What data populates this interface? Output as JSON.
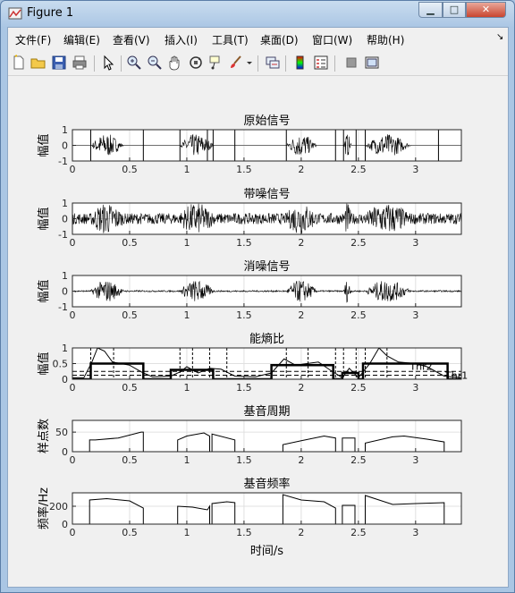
{
  "window": {
    "title": "Figure 1",
    "minimize_glyph": "▁",
    "maximize_glyph": "□",
    "close_glyph": "✕"
  },
  "menubar": {
    "items": [
      "文件(F)",
      "编辑(E)",
      "查看(V)",
      "插入(I)",
      "工具(T)",
      "桌面(D)",
      "窗口(W)",
      "帮助(H)"
    ],
    "dock_glyph": "↘"
  },
  "toolbar": {
    "icons": [
      "new-figure-icon",
      "open-file-icon",
      "save-icon",
      "print-icon",
      "edit-plot-arrow-icon",
      "zoom-in-icon",
      "zoom-out-icon",
      "pan-hand-icon",
      "rotate-3d-icon",
      "data-cursor-icon",
      "brush-icon",
      "brush-dropdown-icon",
      "link-plot-icon",
      "insert-colorbar-icon",
      "insert-legend-icon",
      "hide-plot-tools-icon",
      "show-plot-tools-icon"
    ]
  },
  "colors": {
    "accent_line": "#000000",
    "grid": "#e0e0e0",
    "axes_bg": "#ffffff"
  },
  "chart_data": [
    {
      "type": "line",
      "title": "原始信号",
      "xlabel": "",
      "ylabel": "幅值",
      "xlim": [
        0,
        3.4
      ],
      "ylim": [
        -1,
        1
      ],
      "xticks": [
        "0",
        "0.5",
        "1",
        "1.5",
        "2",
        "2.5",
        "3"
      ],
      "yticks": [
        "-1",
        "0",
        "1"
      ],
      "description_series": "speech waveform",
      "segments": [
        [
          0.16,
          0.62
        ],
        [
          0.94,
          1.42
        ],
        [
          1.87,
          2.3
        ],
        [
          2.37,
          2.48
        ],
        [
          2.56,
          3.2
        ]
      ],
      "vlines": [
        0.16,
        0.62,
        0.94,
        1.18,
        1.23,
        1.42,
        1.87,
        2.3,
        2.37,
        2.48,
        2.56,
        3.2
      ]
    },
    {
      "type": "line",
      "title": "带噪信号",
      "xlabel": "",
      "ylabel": "幅值",
      "xlim": [
        0,
        3.4
      ],
      "ylim": [
        -1,
        1
      ],
      "xticks": [
        "0",
        "0.5",
        "1",
        "1.5",
        "2",
        "2.5",
        "3"
      ],
      "yticks": [
        "-1",
        "0",
        "1"
      ]
    },
    {
      "type": "line",
      "title": "消噪信号",
      "xlabel": "",
      "ylabel": "幅值",
      "xlim": [
        0,
        3.4
      ],
      "ylim": [
        -1,
        1
      ],
      "xticks": [
        "0",
        "0.5",
        "1",
        "1.5",
        "2",
        "2.5",
        "3"
      ],
      "yticks": [
        "-1",
        "0",
        "1"
      ]
    },
    {
      "type": "line",
      "title": "能熵比",
      "xlabel": "",
      "ylabel": "幅值",
      "xlim": [
        0,
        3.4
      ],
      "ylim": [
        0,
        1
      ],
      "xticks": [
        "0",
        "0.5",
        "1",
        "1.5",
        "2",
        "2.5",
        "3"
      ],
      "yticks": [
        "0",
        "0.5",
        "1"
      ],
      "thresholds": [
        {
          "name": "Thr2",
          "value": 0.25
        },
        {
          "name": "Thr1",
          "value": 0.13
        }
      ],
      "annotations": [
        "Thr2",
        "Thr1"
      ],
      "step_series": [
        [
          0,
          0
        ],
        [
          0.16,
          0
        ],
        [
          0.16,
          0.5
        ],
        [
          0.62,
          0.5
        ],
        [
          0.62,
          0
        ],
        [
          0.86,
          0
        ],
        [
          0.86,
          0.3
        ],
        [
          1.23,
          0.3
        ],
        [
          1.23,
          0
        ],
        [
          1.42,
          0
        ],
        [
          1.42,
          0
        ],
        [
          1.74,
          0
        ],
        [
          1.74,
          0.45
        ],
        [
          2.28,
          0.45
        ],
        [
          2.28,
          0
        ],
        [
          2.36,
          0
        ],
        [
          2.36,
          0.2
        ],
        [
          2.5,
          0.2
        ],
        [
          2.5,
          0
        ],
        [
          2.54,
          0
        ],
        [
          2.54,
          0.5
        ],
        [
          3.28,
          0.5
        ],
        [
          3.28,
          0
        ],
        [
          3.4,
          0
        ]
      ],
      "curve": [
        [
          0,
          0.05
        ],
        [
          0.1,
          0.05
        ],
        [
          0.17,
          0.55
        ],
        [
          0.22,
          1.0
        ],
        [
          0.28,
          0.9
        ],
        [
          0.35,
          0.55
        ],
        [
          0.5,
          0.45
        ],
        [
          0.62,
          0.2
        ],
        [
          0.7,
          0.08
        ],
        [
          0.86,
          0.1
        ],
        [
          0.95,
          0.25
        ],
        [
          1.0,
          0.4
        ],
        [
          1.05,
          0.3
        ],
        [
          1.1,
          0.2
        ],
        [
          1.2,
          0.35
        ],
        [
          1.3,
          0.32
        ],
        [
          1.42,
          0.1
        ],
        [
          1.6,
          0.08
        ],
        [
          1.74,
          0.2
        ],
        [
          1.85,
          0.65
        ],
        [
          1.95,
          0.45
        ],
        [
          2.05,
          0.5
        ],
        [
          2.15,
          0.55
        ],
        [
          2.25,
          0.3
        ],
        [
          2.36,
          0.05
        ],
        [
          2.42,
          0.35
        ],
        [
          2.5,
          0.05
        ],
        [
          2.6,
          0.5
        ],
        [
          2.68,
          1.0
        ],
        [
          2.75,
          0.75
        ],
        [
          2.85,
          0.55
        ],
        [
          3.0,
          0.5
        ],
        [
          3.1,
          0.4
        ],
        [
          3.25,
          0.1
        ],
        [
          3.4,
          0.05
        ]
      ],
      "vlines": [
        0.16,
        0.36,
        0.94,
        1.05,
        1.2,
        1.35,
        1.87,
        2.06,
        2.3,
        2.37,
        2.48,
        2.56,
        2.75
      ]
    },
    {
      "type": "line",
      "title": "基音周期",
      "xlabel": "",
      "ylabel": "样点数",
      "xlim": [
        0,
        3.4
      ],
      "ylim": [
        0,
        80
      ],
      "xticks": [
        "0",
        "0.5",
        "1",
        "1.5",
        "2",
        "2.5",
        "3"
      ],
      "yticks": [
        "0",
        "50"
      ],
      "series": [
        [
          0.0,
          0
        ],
        [
          0.15,
          0
        ],
        [
          0.15,
          30
        ],
        [
          0.2,
          30
        ],
        [
          0.4,
          35
        ],
        [
          0.6,
          50
        ],
        [
          0.62,
          50
        ],
        [
          0.62,
          0
        ],
        [
          0.92,
          0
        ],
        [
          0.92,
          30
        ],
        [
          1.0,
          40
        ],
        [
          1.15,
          48
        ],
        [
          1.2,
          40
        ],
        [
          1.2,
          0
        ],
        [
          1.22,
          0
        ],
        [
          1.22,
          45
        ],
        [
          1.42,
          30
        ],
        [
          1.42,
          0
        ],
        [
          1.6,
          0
        ],
        [
          1.84,
          0
        ],
        [
          1.84,
          18
        ],
        [
          2.0,
          28
        ],
        [
          2.2,
          40
        ],
        [
          2.3,
          35
        ],
        [
          2.3,
          0
        ],
        [
          2.36,
          0
        ],
        [
          2.36,
          35
        ],
        [
          2.47,
          35
        ],
        [
          2.47,
          0
        ],
        [
          2.56,
          0
        ],
        [
          2.56,
          22
        ],
        [
          2.8,
          38
        ],
        [
          2.9,
          40
        ],
        [
          3.1,
          32
        ],
        [
          3.25,
          25
        ],
        [
          3.25,
          0
        ],
        [
          3.4,
          0
        ]
      ]
    },
    {
      "type": "line",
      "title": "基音频率",
      "xlabel": "时间/s",
      "ylabel": "频率/Hz",
      "xlim": [
        0,
        3.4
      ],
      "ylim": [
        0,
        350
      ],
      "xticks": [
        "0",
        "0.5",
        "1",
        "1.5",
        "2",
        "2.5",
        "3"
      ],
      "yticks": [
        "0",
        "200"
      ],
      "series": [
        [
          0.0,
          0
        ],
        [
          0.15,
          0
        ],
        [
          0.15,
          270
        ],
        [
          0.3,
          285
        ],
        [
          0.5,
          260
        ],
        [
          0.62,
          180
        ],
        [
          0.62,
          0
        ],
        [
          0.92,
          0
        ],
        [
          0.92,
          200
        ],
        [
          1.05,
          190
        ],
        [
          1.18,
          160
        ],
        [
          1.2,
          200
        ],
        [
          1.2,
          0
        ],
        [
          1.22,
          0
        ],
        [
          1.22,
          230
        ],
        [
          1.35,
          250
        ],
        [
          1.42,
          240
        ],
        [
          1.42,
          0
        ],
        [
          1.6,
          0
        ],
        [
          1.84,
          0
        ],
        [
          1.84,
          330
        ],
        [
          2.0,
          270
        ],
        [
          2.2,
          250
        ],
        [
          2.3,
          180
        ],
        [
          2.3,
          0
        ],
        [
          2.36,
          0
        ],
        [
          2.36,
          210
        ],
        [
          2.47,
          210
        ],
        [
          2.47,
          0
        ],
        [
          2.56,
          0
        ],
        [
          2.56,
          320
        ],
        [
          2.8,
          220
        ],
        [
          3.0,
          230
        ],
        [
          3.25,
          240
        ],
        [
          3.25,
          0
        ],
        [
          3.4,
          0
        ]
      ]
    }
  ]
}
